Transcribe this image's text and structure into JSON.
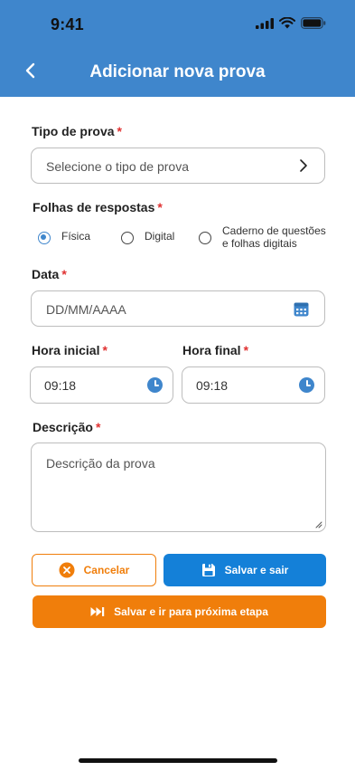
{
  "status_bar": {
    "time": "9:41"
  },
  "header": {
    "title": "Adicionar nova prova"
  },
  "colors": {
    "primary": "#3f86cc",
    "accent": "#f07e0b",
    "save": "#1480d8",
    "required": "#e03131"
  },
  "form": {
    "tipo": {
      "label": "Tipo de prova",
      "required_mark": "*",
      "placeholder": "Selecione o tipo de prova",
      "icon": "chevron-right-icon"
    },
    "folhas": {
      "label": "Folhas de respostas",
      "required_mark": "*",
      "options": [
        {
          "label": "Física",
          "selected": true
        },
        {
          "label": "Digital",
          "selected": false
        },
        {
          "label": "Caderno de questões e folhas digitais",
          "selected": false
        }
      ]
    },
    "data": {
      "label": "Data",
      "required_mark": "*",
      "placeholder": "DD/MM/AAAA",
      "icon": "calendar-icon"
    },
    "hora_inicial": {
      "label": "Hora inicial",
      "required_mark": "*",
      "value": "09:18",
      "icon": "clock-icon"
    },
    "hora_final": {
      "label": "Hora final",
      "required_mark": "*",
      "value": "09:18",
      "icon": "clock-icon"
    },
    "descricao": {
      "label": "Descrição",
      "required_mark": "*",
      "placeholder": "Descrição da prova"
    }
  },
  "actions": {
    "cancel": {
      "label": "Cancelar",
      "icon": "close-circle-icon"
    },
    "save_exit": {
      "label": "Salvar e sair",
      "icon": "floppy-disk-icon"
    },
    "save_next": {
      "label": "Salvar e ir para próxima etapa",
      "icon": "skip-forward-icon"
    }
  }
}
